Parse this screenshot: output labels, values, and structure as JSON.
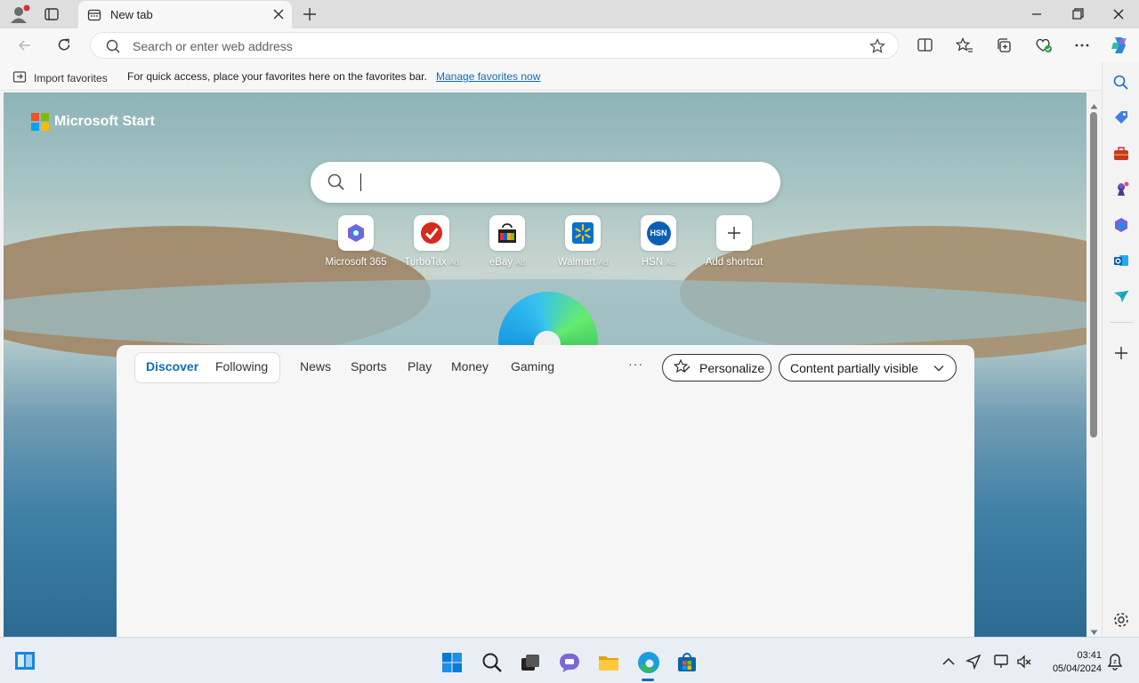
{
  "browser": {
    "tab": {
      "title": "New tab"
    },
    "address_bar": {
      "placeholder": "Search or enter web address"
    },
    "favorites_bar": {
      "import_label": "Import favorites",
      "hint": "For quick access, place your favorites here on the favorites bar.",
      "manage_link": "Manage favorites now"
    }
  },
  "page": {
    "brand": "Microsoft Start",
    "search": {
      "value": ""
    },
    "shortcuts": [
      {
        "label": "Microsoft 365",
        "ad": "",
        "icon": "microsoft365-icon"
      },
      {
        "label": "TurboTax",
        "ad": "Ad",
        "icon": "turbotax-icon"
      },
      {
        "label": "eBay",
        "ad": "Ad",
        "icon": "ebay-icon"
      },
      {
        "label": "Walmart",
        "ad": "Ad",
        "icon": "walmart-icon"
      },
      {
        "label": "HSN",
        "ad": "Ad",
        "icon": "hsn-icon"
      },
      {
        "label": "Add shortcut",
        "ad": "",
        "icon": "plus-icon"
      }
    ],
    "hsn_badge": "HSN",
    "feed": {
      "pivot": [
        "Discover",
        "Following"
      ],
      "active": "Discover",
      "categories": [
        "News",
        "Sports",
        "Play",
        "Money",
        "Gaming"
      ],
      "more": "···",
      "personalize": "Personalize",
      "visibility": "Content partially visible"
    }
  },
  "taskbar": {
    "time": "03:41",
    "date": "05/04/2024"
  },
  "colors": {
    "accent": "#0f6cbd",
    "edge_blue": "#0c59a4",
    "edge_green": "#2fba5e"
  }
}
